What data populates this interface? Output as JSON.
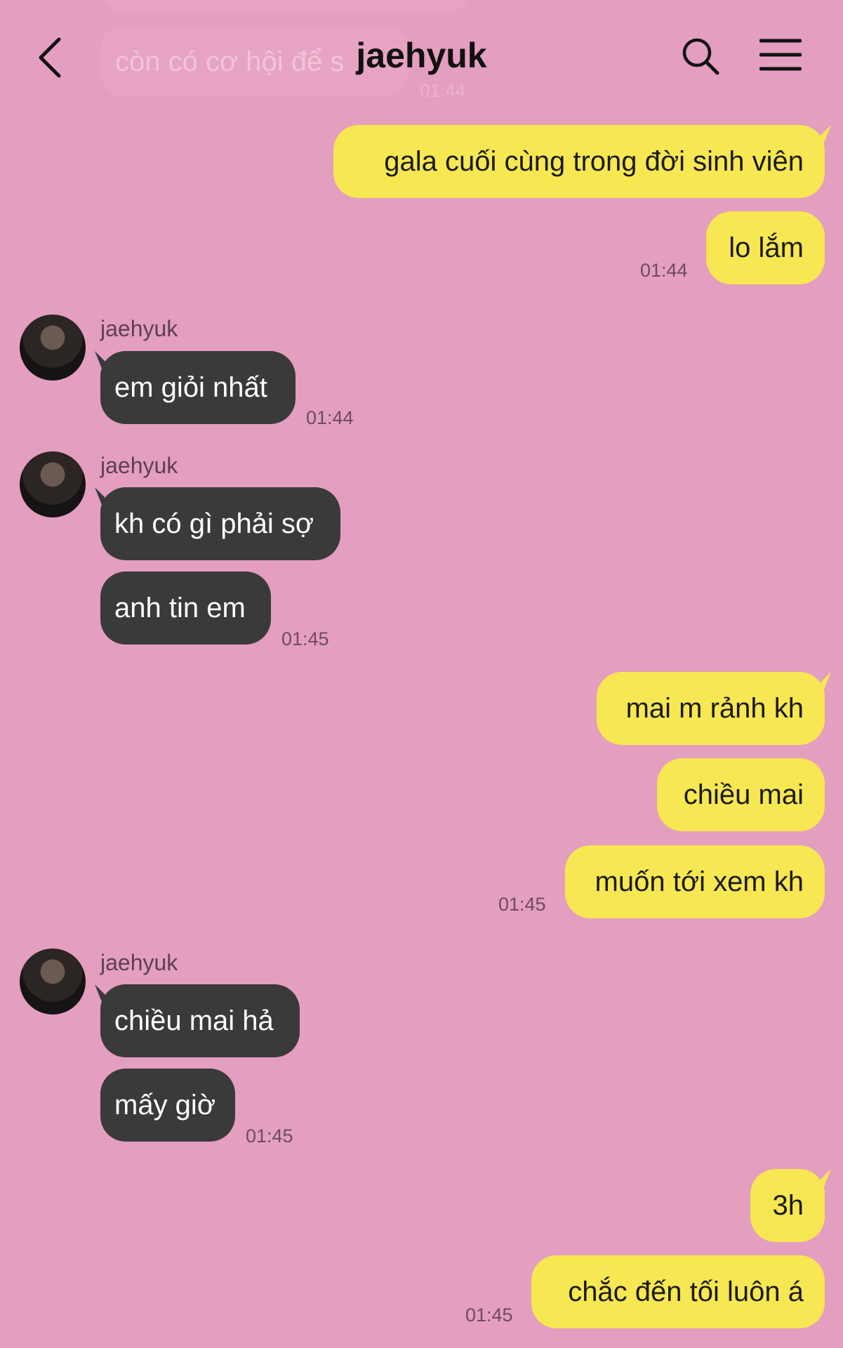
{
  "header": {
    "title": "jaehyuk"
  },
  "ghost": {
    "text": "còn có cơ hội để s",
    "time": "01:44"
  },
  "messages": {
    "m1": {
      "text": "gala cuối cùng trong đời sinh viên"
    },
    "m2": {
      "text": "lo lắm",
      "time": "01:44"
    },
    "r1": {
      "sender": "jaehyuk",
      "text": "em giỏi nhất",
      "time": "01:44"
    },
    "r2": {
      "sender": "jaehyuk",
      "text1": "kh có gì phải sợ",
      "text2": "anh tin em",
      "time": "01:45"
    },
    "m3": {
      "text1": "mai m rảnh kh",
      "text2": "chiều mai",
      "text3": "muốn tới xem kh",
      "time": "01:45"
    },
    "r3": {
      "sender": "jaehyuk",
      "text1": "chiều mai hả",
      "text2": "mấy giờ",
      "time": "01:45"
    },
    "m4": {
      "text1": "3h",
      "text2": "chắc đến tối luôn á",
      "time": "01:45"
    }
  },
  "colors": {
    "background": "#e49ebf",
    "outgoing": "#f7e752",
    "incoming": "#3a3a3a"
  },
  "icons": [
    "chevron-left-icon",
    "search-icon",
    "menu-icon"
  ]
}
